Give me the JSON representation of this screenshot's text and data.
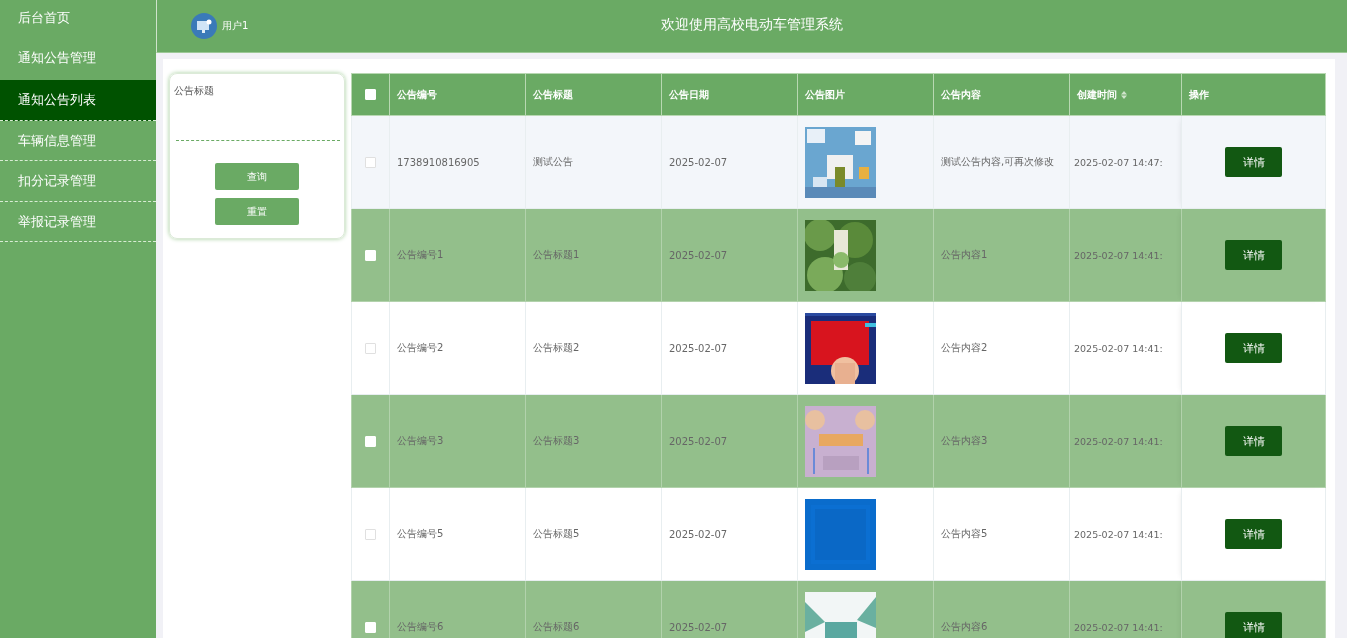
{
  "sidebar": {
    "items": [
      {
        "label": "后台首页",
        "selected": false
      },
      {
        "label": "通知公告管理",
        "selected": false
      },
      {
        "label": "通知公告列表",
        "selected": true
      },
      {
        "label": "车辆信息管理",
        "selected": false
      },
      {
        "label": "扣分记录管理",
        "selected": false
      },
      {
        "label": "举报记录管理",
        "selected": false
      }
    ]
  },
  "header": {
    "user": "用户1",
    "title": "欢迎使用高校电动车管理系统"
  },
  "search": {
    "label": "公告标题",
    "buttons": [
      "查询",
      "重置"
    ]
  },
  "table": {
    "select_all": {
      "checked": false
    },
    "columns": [
      "公告编号",
      "公告标题",
      "公告日期",
      "公告图片",
      "公告内容",
      "创建时间",
      "操作"
    ],
    "rows": [
      {
        "checked": false,
        "hovered": true,
        "number": "1738910816905",
        "title": "测试公告",
        "date": "2025-02-07",
        "content": "测试公告内容,可再次修改",
        "created": "2025-02-07 14:47:",
        "action": "详情"
      },
      {
        "checked": false,
        "hovered": false,
        "number": "公告编号1",
        "title": "公告标题1",
        "date": "2025-02-07",
        "content": "公告内容1",
        "created": "2025-02-07 14:41:",
        "action": "详情"
      },
      {
        "checked": false,
        "hovered": false,
        "number": "公告编号2",
        "title": "公告标题2",
        "date": "2025-02-07",
        "content": "公告内容2",
        "created": "2025-02-07 14:41:",
        "action": "详情"
      },
      {
        "checked": false,
        "hovered": false,
        "number": "公告编号3",
        "title": "公告标题3",
        "date": "2025-02-07",
        "content": "公告内容3",
        "created": "2025-02-07 14:41:",
        "action": "详情"
      },
      {
        "checked": false,
        "hovered": false,
        "number": "公告编号5",
        "title": "公告标题5",
        "date": "2025-02-07",
        "content": "公告内容5",
        "created": "2025-02-07 14:41:",
        "action": "详情"
      },
      {
        "checked": false,
        "hovered": false,
        "number": "公告编号6",
        "title": "公告标题6",
        "date": "2025-02-07",
        "content": "公告内容6",
        "created": "2025-02-07 14:41:",
        "action": "详情"
      }
    ]
  }
}
